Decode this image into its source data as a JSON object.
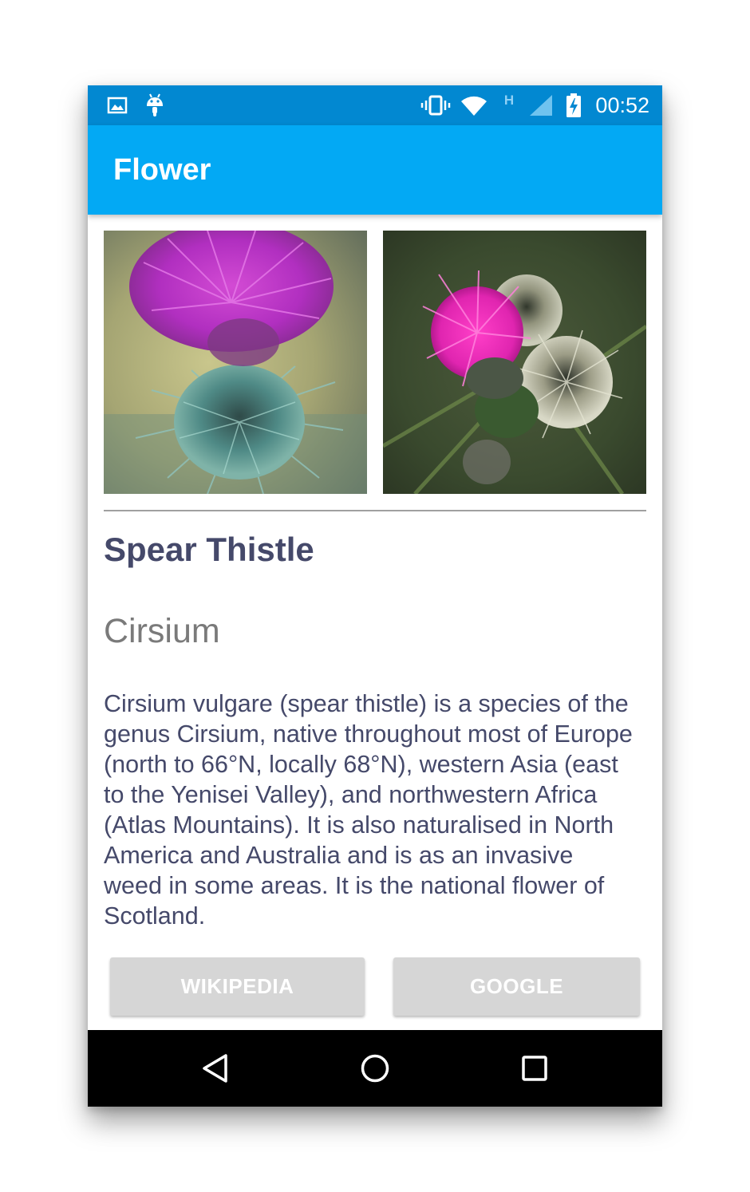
{
  "status_bar": {
    "time": "00:52",
    "icons": [
      "image-notification-icon",
      "android-notification-icon",
      "vibrate-icon",
      "wifi-icon",
      "network-h-icon",
      "signal-icon",
      "battery-charging-icon"
    ],
    "network_label": "H",
    "background_color": "#0288d1"
  },
  "app_bar": {
    "title": "Flower",
    "background_color": "#03a9f4"
  },
  "flower": {
    "name": "Spear Thistle",
    "genus": "Cirsium",
    "description": "Cirsium vulgare (spear thistle) is a species of the\ngenus Cirsium, native throughout most of Europe\n(north to 66°N, locally 68°N), western Asia (east\nto the Yenisei Valley), and northwestern Africa\n(Atlas Mountains). It is also naturalised in North\nAmerica and Australia and is as an invasive\nweed in some areas. It is the national flower of\nScotland.",
    "name_color": "#45496a",
    "genus_color": "#7a7a7a"
  },
  "buttons": {
    "wikipedia": "WIKIPEDIA",
    "google": "GOOGLE",
    "background_color": "#d6d6d6"
  },
  "nav_bar": {
    "icons": [
      "back-icon",
      "home-icon",
      "recents-icon"
    ]
  }
}
